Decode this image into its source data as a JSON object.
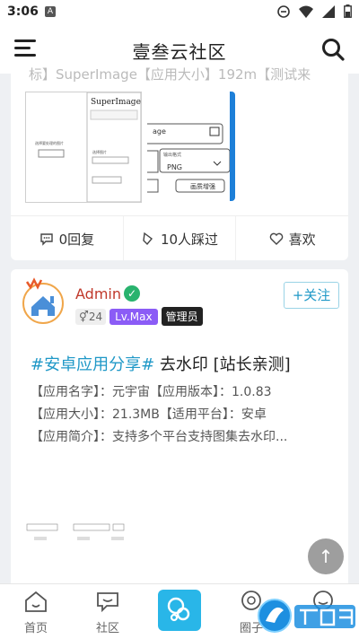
{
  "status": {
    "time": "3:06",
    "badge": "A"
  },
  "header": {
    "title": "壹叁云社区"
  },
  "card1": {
    "cut_text": "标】SuperImage【应用大小】192m【测试来",
    "thumb_title": "SuperImage",
    "thumb_right_title": "age",
    "thumb_format": "PNG",
    "thumb_enhance": "画质增强",
    "actions": {
      "comments": "0回复",
      "views": "10人踩过",
      "like": "喜欢"
    }
  },
  "card2": {
    "user": "Admin",
    "gender_age": "24",
    "level": "Lv.Max",
    "role": "管理员",
    "follow": "+关注",
    "title_hashtag": "#安卓应用分享#",
    "title_rest": " 去水印 [站长亲测]",
    "line1": "【应用名字】：元宇宙【应用版本】：1.0.83",
    "line2": "【应用大小】：21.3MB【适用平台】：安卓",
    "line3": "【应用简介】：支持多个平台支持图集去水印..."
  },
  "nav": {
    "home": "首页",
    "community": "社区",
    "circle": "圈子"
  },
  "colors": {
    "accent": "#29b6e8",
    "follow": "#1f98c7",
    "level": "#8b5cf6"
  }
}
